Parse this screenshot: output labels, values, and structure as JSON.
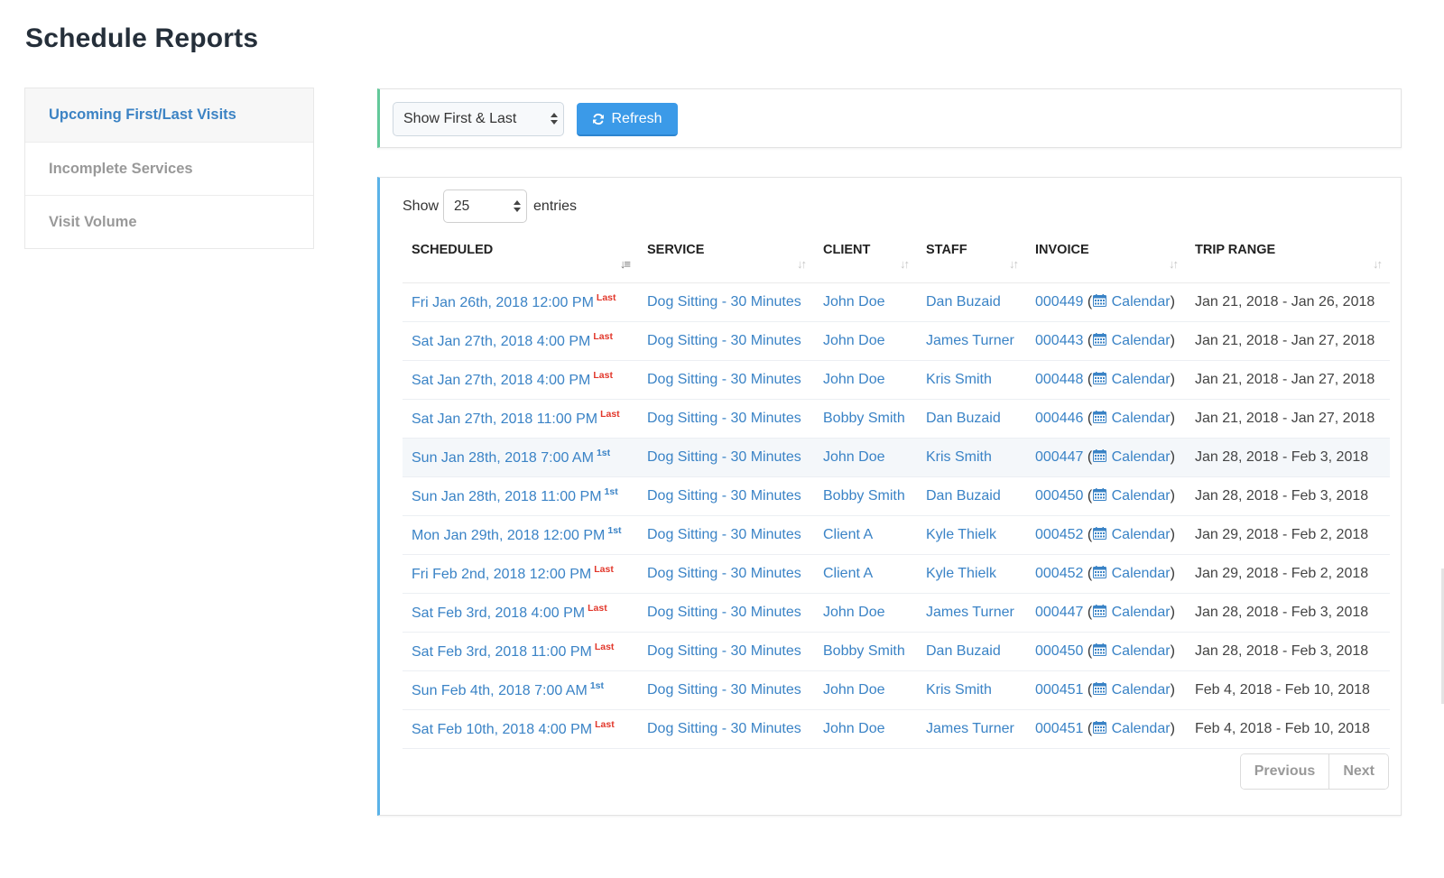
{
  "page": {
    "title": "Schedule Reports"
  },
  "sidebar": {
    "items": [
      {
        "label": "Upcoming First/Last Visits",
        "active": true
      },
      {
        "label": "Incomplete Services",
        "active": false
      },
      {
        "label": "Visit Volume",
        "active": false
      }
    ]
  },
  "filters": {
    "mode_select": {
      "value": "Show First & Last"
    },
    "refresh_label": "Refresh",
    "refresh_icon": "refresh-icon"
  },
  "table": {
    "length": {
      "prefix": "Show",
      "value": "25",
      "suffix": "entries"
    },
    "columns": [
      {
        "label": "SCHEDULED",
        "sort": "descending"
      },
      {
        "label": "SERVICE",
        "sort": "none"
      },
      {
        "label": "CLIENT",
        "sort": "none"
      },
      {
        "label": "STAFF",
        "sort": "none"
      },
      {
        "label": "INVOICE",
        "sort": "none"
      },
      {
        "label": "TRIP RANGE",
        "sort": "none"
      }
    ],
    "rows": [
      {
        "scheduled": "Fri Jan 26th, 2018 12:00 PM",
        "tag": "Last",
        "service": "Dog Sitting - 30 Minutes",
        "client": "John Doe",
        "staff": "Dan Buzaid",
        "invoice": "000449",
        "calendar": "Calendar",
        "trip_range": "Jan 21, 2018 - Jan 26, 2018"
      },
      {
        "scheduled": "Sat Jan 27th, 2018 4:00 PM",
        "tag": "Last",
        "service": "Dog Sitting - 30 Minutes",
        "client": "John Doe",
        "staff": "James Turner",
        "invoice": "000443",
        "calendar": "Calendar",
        "trip_range": "Jan 21, 2018 - Jan 27, 2018"
      },
      {
        "scheduled": "Sat Jan 27th, 2018 4:00 PM",
        "tag": "Last",
        "service": "Dog Sitting - 30 Minutes",
        "client": "John Doe",
        "staff": "Kris Smith",
        "invoice": "000448",
        "calendar": "Calendar",
        "trip_range": "Jan 21, 2018 - Jan 27, 2018"
      },
      {
        "scheduled": "Sat Jan 27th, 2018 11:00 PM",
        "tag": "Last",
        "service": "Dog Sitting - 30 Minutes",
        "client": "Bobby Smith",
        "staff": "Dan Buzaid",
        "invoice": "000446",
        "calendar": "Calendar",
        "trip_range": "Jan 21, 2018 - Jan 27, 2018"
      },
      {
        "scheduled": "Sun Jan 28th, 2018 7:00 AM",
        "tag": "1st",
        "service": "Dog Sitting - 30 Minutes",
        "client": "John Doe",
        "staff": "Kris Smith",
        "invoice": "000447",
        "calendar": "Calendar",
        "trip_range": "Jan 28, 2018 - Feb 3, 2018",
        "hovered": true
      },
      {
        "scheduled": "Sun Jan 28th, 2018 11:00 PM",
        "tag": "1st",
        "service": "Dog Sitting - 30 Minutes",
        "client": "Bobby Smith",
        "staff": "Dan Buzaid",
        "invoice": "000450",
        "calendar": "Calendar",
        "trip_range": "Jan 28, 2018 - Feb 3, 2018"
      },
      {
        "scheduled": "Mon Jan 29th, 2018 12:00 PM",
        "tag": "1st",
        "service": "Dog Sitting - 30 Minutes",
        "client": "Client A",
        "staff": "Kyle Thielk",
        "invoice": "000452",
        "calendar": "Calendar",
        "trip_range": "Jan 29, 2018 - Feb 2, 2018"
      },
      {
        "scheduled": "Fri Feb 2nd, 2018 12:00 PM",
        "tag": "Last",
        "service": "Dog Sitting - 30 Minutes",
        "client": "Client A",
        "staff": "Kyle Thielk",
        "invoice": "000452",
        "calendar": "Calendar",
        "trip_range": "Jan 29, 2018 - Feb 2, 2018"
      },
      {
        "scheduled": "Sat Feb 3rd, 2018 4:00 PM",
        "tag": "Last",
        "service": "Dog Sitting - 30 Minutes",
        "client": "John Doe",
        "staff": "James Turner",
        "invoice": "000447",
        "calendar": "Calendar",
        "trip_range": "Jan 28, 2018 - Feb 3, 2018"
      },
      {
        "scheduled": "Sat Feb 3rd, 2018 11:00 PM",
        "tag": "Last",
        "service": "Dog Sitting - 30 Minutes",
        "client": "Bobby Smith",
        "staff": "Dan Buzaid",
        "invoice": "000450",
        "calendar": "Calendar",
        "trip_range": "Jan 28, 2018 - Feb 3, 2018"
      },
      {
        "scheduled": "Sun Feb 4th, 2018 7:00 AM",
        "tag": "1st",
        "service": "Dog Sitting - 30 Minutes",
        "client": "John Doe",
        "staff": "Kris Smith",
        "invoice": "000451",
        "calendar": "Calendar",
        "trip_range": "Feb 4, 2018 - Feb 10, 2018"
      },
      {
        "scheduled": "Sat Feb 10th, 2018 4:00 PM",
        "tag": "Last",
        "service": "Dog Sitting - 30 Minutes",
        "client": "John Doe",
        "staff": "James Turner",
        "invoice": "000451",
        "calendar": "Calendar",
        "trip_range": "Feb 4, 2018 - Feb 10, 2018"
      }
    ],
    "pagination": {
      "previous": "Previous",
      "next": "Next"
    }
  },
  "colors": {
    "link": "#3a83c6",
    "tag_last": "#e2372b",
    "tag_first": "#3a83c6",
    "primary_button": "#3b9ae8",
    "filter_panel_accent": "#63c99a",
    "table_panel_accent": "#5ab2e8"
  }
}
